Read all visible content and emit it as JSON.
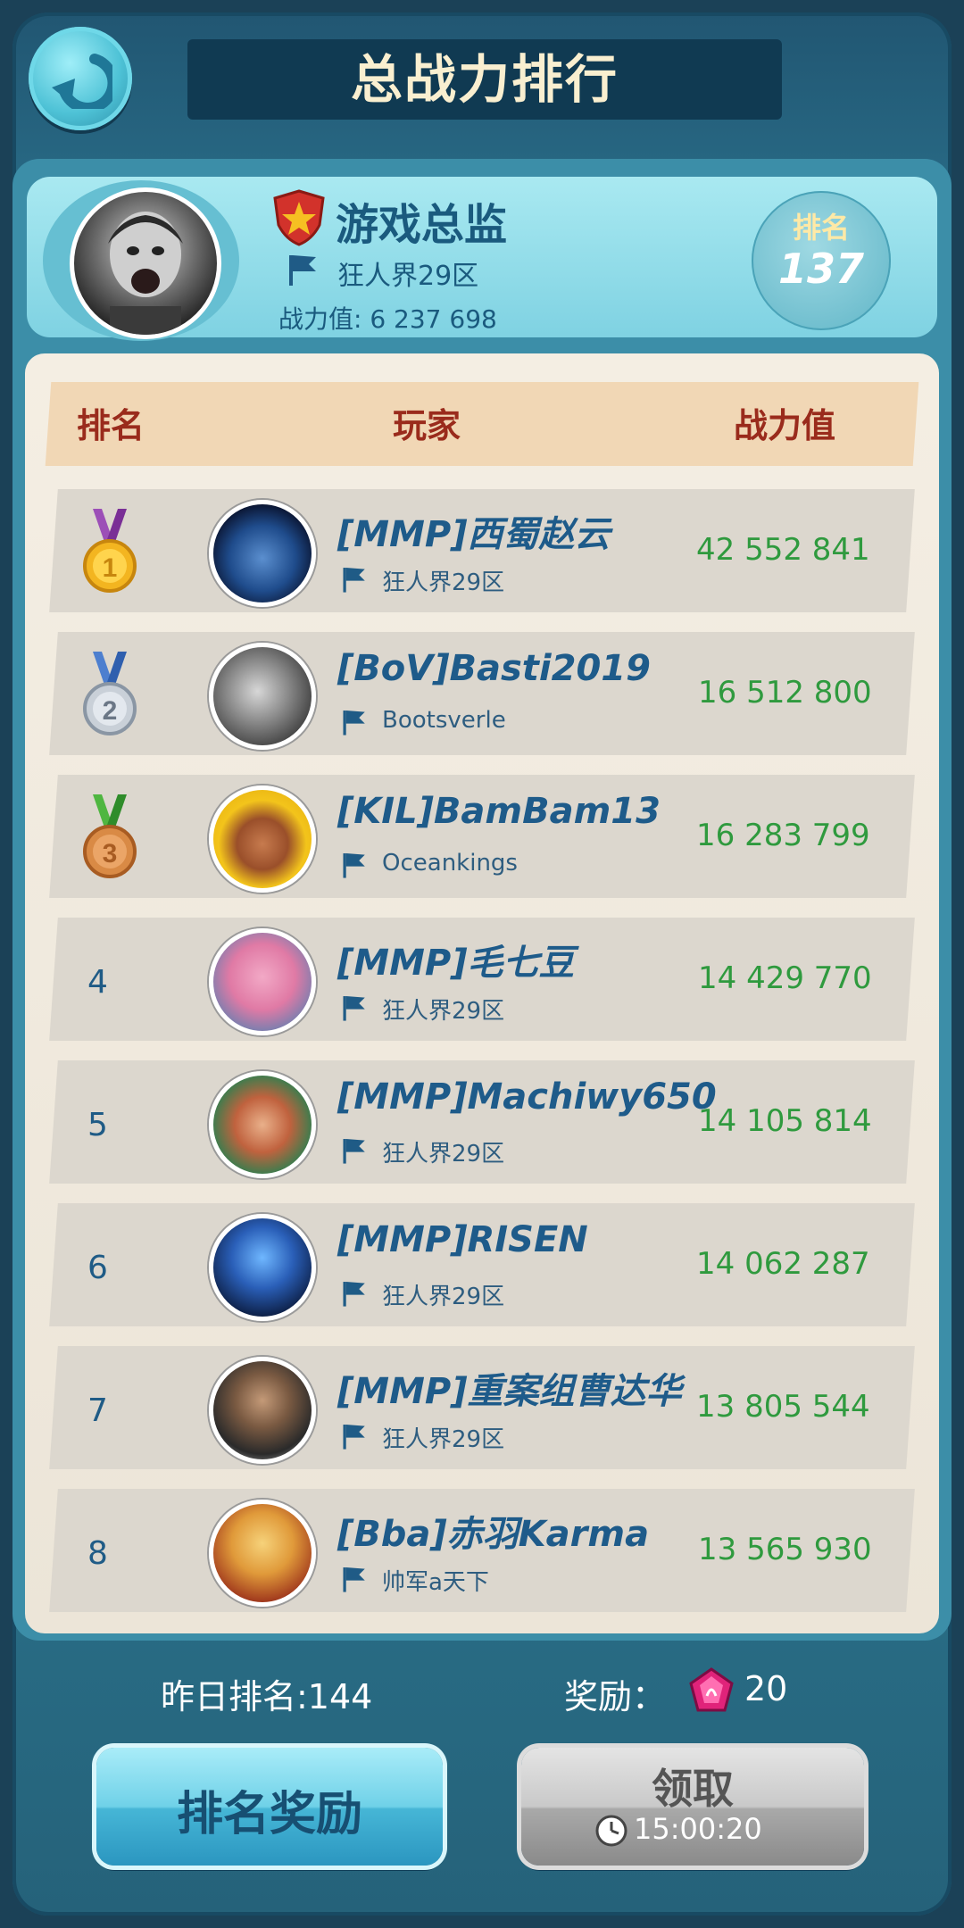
{
  "header": {
    "title": "总战力排行",
    "back_icon": "back-arrow-icon"
  },
  "me": {
    "name": "游戏总监",
    "server": "狂人界29区",
    "power_label": "战力值: 6 237 698",
    "rank_label": "排名",
    "rank_value": "137"
  },
  "table": {
    "col_rank": "排名",
    "col_player": "玩家",
    "col_power": "战力值"
  },
  "rows": [
    {
      "rank": "1",
      "medal": "gold",
      "name": "[MMP]西蜀赵云",
      "server": "狂人界29区",
      "power": "42 552 841"
    },
    {
      "rank": "2",
      "medal": "silver",
      "name": "[BoV]Basti2019",
      "server": "Bootsverle",
      "power": "16 512 800"
    },
    {
      "rank": "3",
      "medal": "bronze",
      "name": "[KIL]BamBam13",
      "server": "Oceankings",
      "power": "16 283 799"
    },
    {
      "rank": "4",
      "name": "[MMP]毛七豆",
      "server": "狂人界29区",
      "power": "14 429 770"
    },
    {
      "rank": "5",
      "name": "[MMP]Machiwy650",
      "server": "狂人界29区",
      "power": "14 105 814"
    },
    {
      "rank": "6",
      "name": "[MMP]RISEN",
      "server": "狂人界29区",
      "power": "14 062 287"
    },
    {
      "rank": "7",
      "name": "[MMP]重案组曹达华",
      "server": "狂人界29区",
      "power": "13 805 544"
    },
    {
      "rank": "8",
      "name": "[Bba]赤羽Karma",
      "server": "帅军a天下",
      "power": "13 565 930"
    }
  ],
  "footer": {
    "yesterday_rank": "昨日排名:144",
    "reward_label": "奖励：",
    "reward_value": "20",
    "rank_reward_button": "排名奖励",
    "claim_button": "领取",
    "timer": "15:00:20"
  },
  "colors": {
    "accent": "#2f9a3e",
    "name": "#1e5b8a",
    "header_text": "#9a2b1c"
  }
}
